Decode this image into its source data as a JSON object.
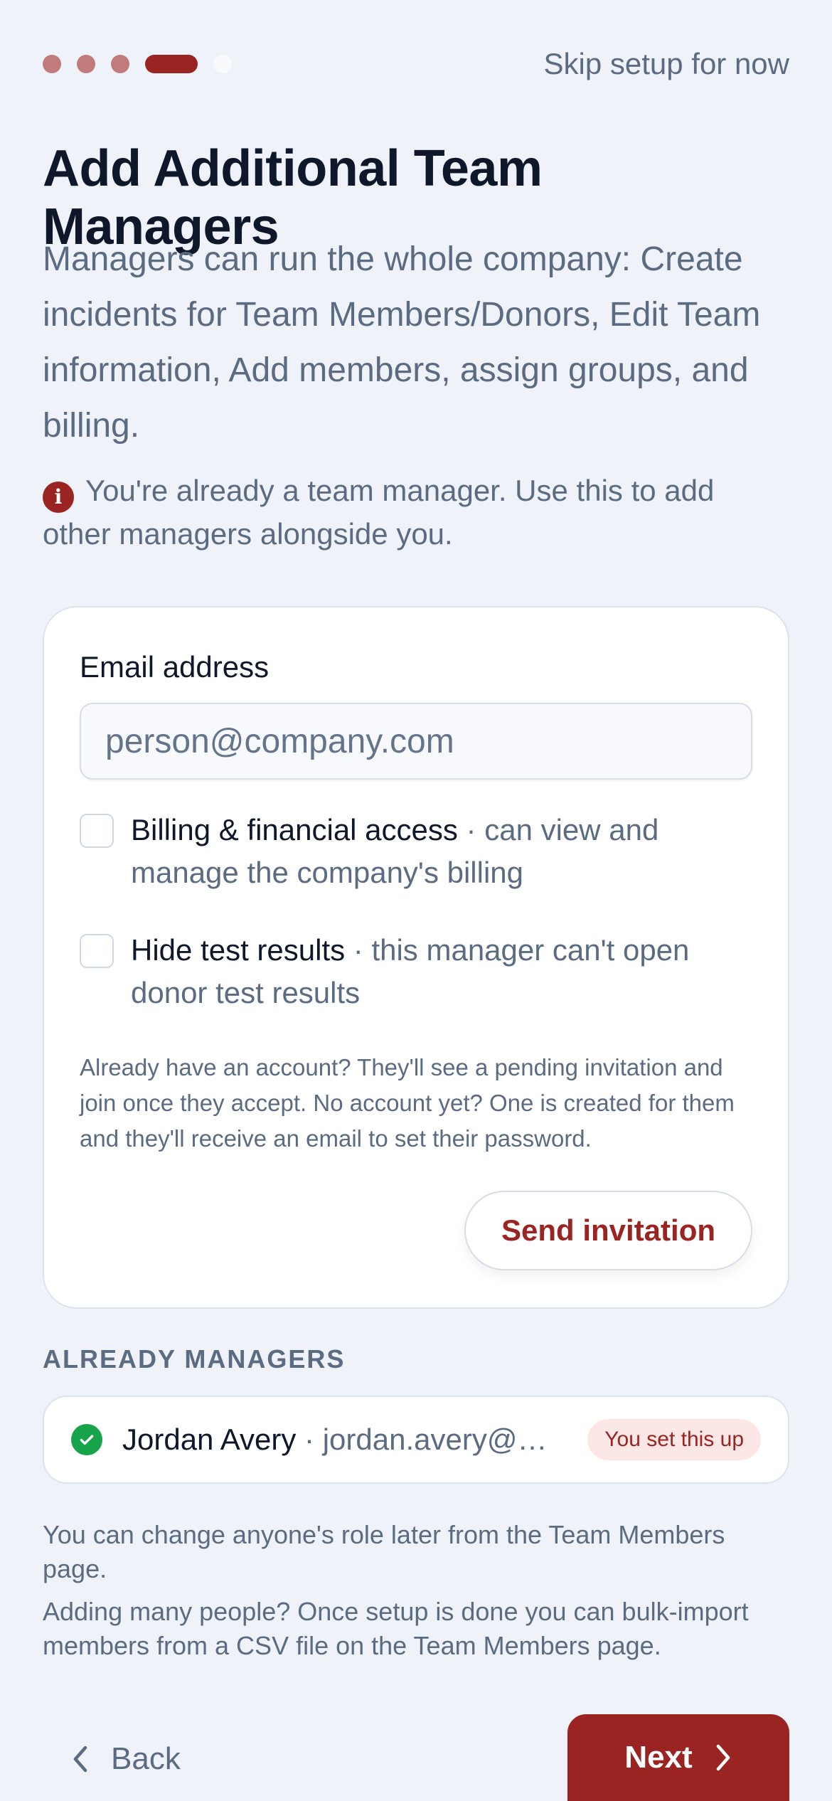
{
  "progress": {
    "total_steps": 5,
    "current_step": 4
  },
  "header": {
    "skip_label": "Skip setup for now"
  },
  "page": {
    "title": "Add Additional Team Managers",
    "description": "Managers can run the whole company: Create incidents for Team Members/Donors, Edit Team information, Add members, assign groups, and billing.",
    "note": "You're already a team manager. Use this to add other managers alongside you."
  },
  "form": {
    "email_label": "Email address",
    "email_value": "",
    "email_placeholder": "person@company.com",
    "options": [
      {
        "title": "Billing & financial access",
        "detail": " · can view and manage the company's billing",
        "checked": false
      },
      {
        "title": "Hide test results",
        "detail": " · this manager can't open donor test results",
        "checked": false
      }
    ],
    "fineprint": "Already have an account? They'll see a pending invitation and join once they accept. No account yet? One is created for them and they'll receive an email to set their password.",
    "send_label": "Send invitation"
  },
  "managers": {
    "section_label": "ALREADY MANAGERS",
    "items": [
      {
        "name": "Jordan Avery",
        "email": " · jordan.avery@…",
        "badge": "You set this up"
      }
    ]
  },
  "help": {
    "line1": "You can change anyone's role later from the Team Members page.",
    "line2": "Adding many people? Once setup is done you can bulk-import members from a CSV file on the Team Members page."
  },
  "footer": {
    "back_label": "Back",
    "next_label": "Next"
  },
  "colors": {
    "accent": "#9a2421",
    "success": "#16a34a",
    "muted_text": "#5b6b82",
    "background": "#eff2f8"
  },
  "icons": [
    "info-icon",
    "check-circle-icon",
    "chevron-left-icon",
    "chevron-right-icon"
  ]
}
